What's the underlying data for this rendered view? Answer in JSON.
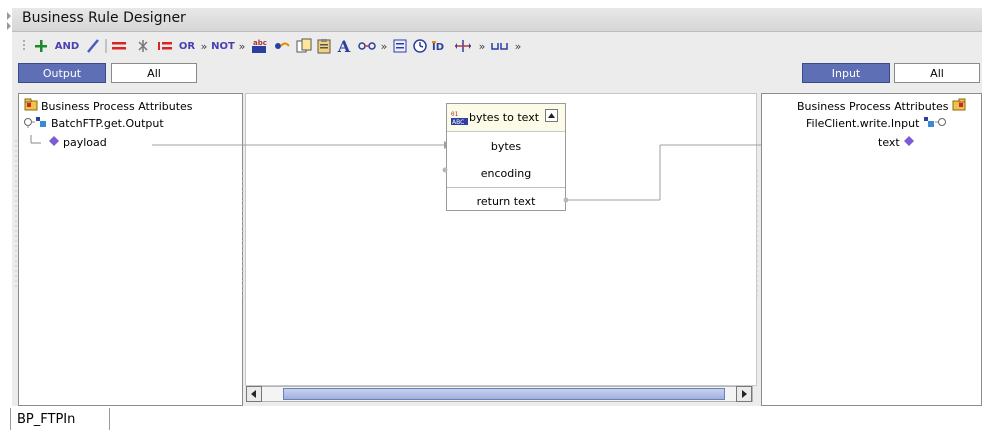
{
  "window": {
    "title": "Business Rule Designer"
  },
  "toolbar": {
    "and_label": "AND",
    "or_label": "OR",
    "not_label": "NOT",
    "overflow": "»"
  },
  "left_panel": {
    "tab_output": "Output",
    "tab_all": "All",
    "root_label": "Business Process Attributes",
    "node_label": "BatchFTP.get.Output",
    "leaf_label": "payload"
  },
  "right_panel": {
    "tab_input": "Input",
    "tab_all": "All",
    "root_label": "Business Process Attributes",
    "node_label": "FileClient.write.Input",
    "leaf_label": "text"
  },
  "function_box": {
    "title": "bytes to text",
    "inputs": [
      "bytes",
      "encoding"
    ],
    "output": "return text"
  },
  "statusbar": {
    "tab_label": "BP_FTPIn"
  },
  "colors": {
    "selected_tab": "#5e6fb5",
    "link": "#a0a0a0",
    "diamond": "#7b5cd6"
  }
}
